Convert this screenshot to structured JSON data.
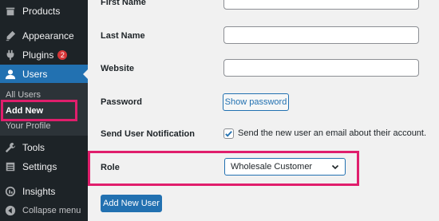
{
  "sidebar": {
    "items": [
      {
        "label": "Products",
        "icon": "products-icon"
      },
      {
        "label": "Appearance",
        "icon": "appearance-icon"
      },
      {
        "label": "Plugins",
        "icon": "plugins-icon",
        "badge": "2"
      },
      {
        "label": "Users",
        "icon": "users-icon"
      },
      {
        "label": "Tools",
        "icon": "tools-icon"
      },
      {
        "label": "Settings",
        "icon": "settings-icon"
      },
      {
        "label": "Insights",
        "icon": "insights-icon"
      },
      {
        "label": "Collapse menu",
        "icon": "collapse-icon"
      }
    ],
    "users_submenu": [
      "All Users",
      "Add New",
      "Your Profile"
    ]
  },
  "form": {
    "first_name_label": "First Name",
    "last_name_label": "Last Name",
    "website_label": "Website",
    "password_label": "Password",
    "show_password": "Show password",
    "notification_label": "Send User Notification",
    "notification_text": "Send the new user an email about their account.",
    "notification_checked": true,
    "role_label": "Role",
    "role_value": "Wholesale Customer",
    "submit": "Add New User"
  },
  "colors": {
    "sidebar_bg": "#1d2327",
    "accent": "#2271b1",
    "highlight": "#e01e6c",
    "badge": "#d63638"
  }
}
